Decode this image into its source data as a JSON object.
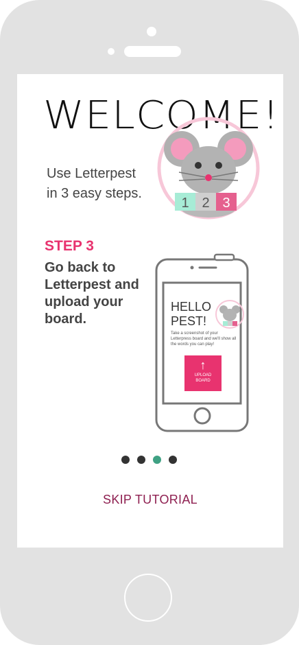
{
  "welcome": {
    "title": "WELCOME!"
  },
  "intro": {
    "line1": "Use Letterpest",
    "line2": "in 3 easy steps."
  },
  "mascot_badges": [
    "1",
    "2",
    "3"
  ],
  "step": {
    "label": "STEP 3",
    "text": "Go back to Letterpest and upload your board."
  },
  "mini_screen": {
    "hello": "HELLO",
    "pest": "PEST!",
    "description": "Take a screenshot of your Letterpress board and we'll show all the words you can play!",
    "upload_line1": "UPLOAD",
    "upload_line2": "BOARD",
    "mini_badges": [
      "1",
      "2",
      "3"
    ]
  },
  "pagination": {
    "total": 4,
    "current": 3
  },
  "skip": {
    "label": "SKIP TUTORIAL"
  },
  "colors": {
    "accent": "#e8336f",
    "skip": "#8e1f50",
    "active_dot": "#3fa183",
    "frame": "#e2e2e2"
  }
}
